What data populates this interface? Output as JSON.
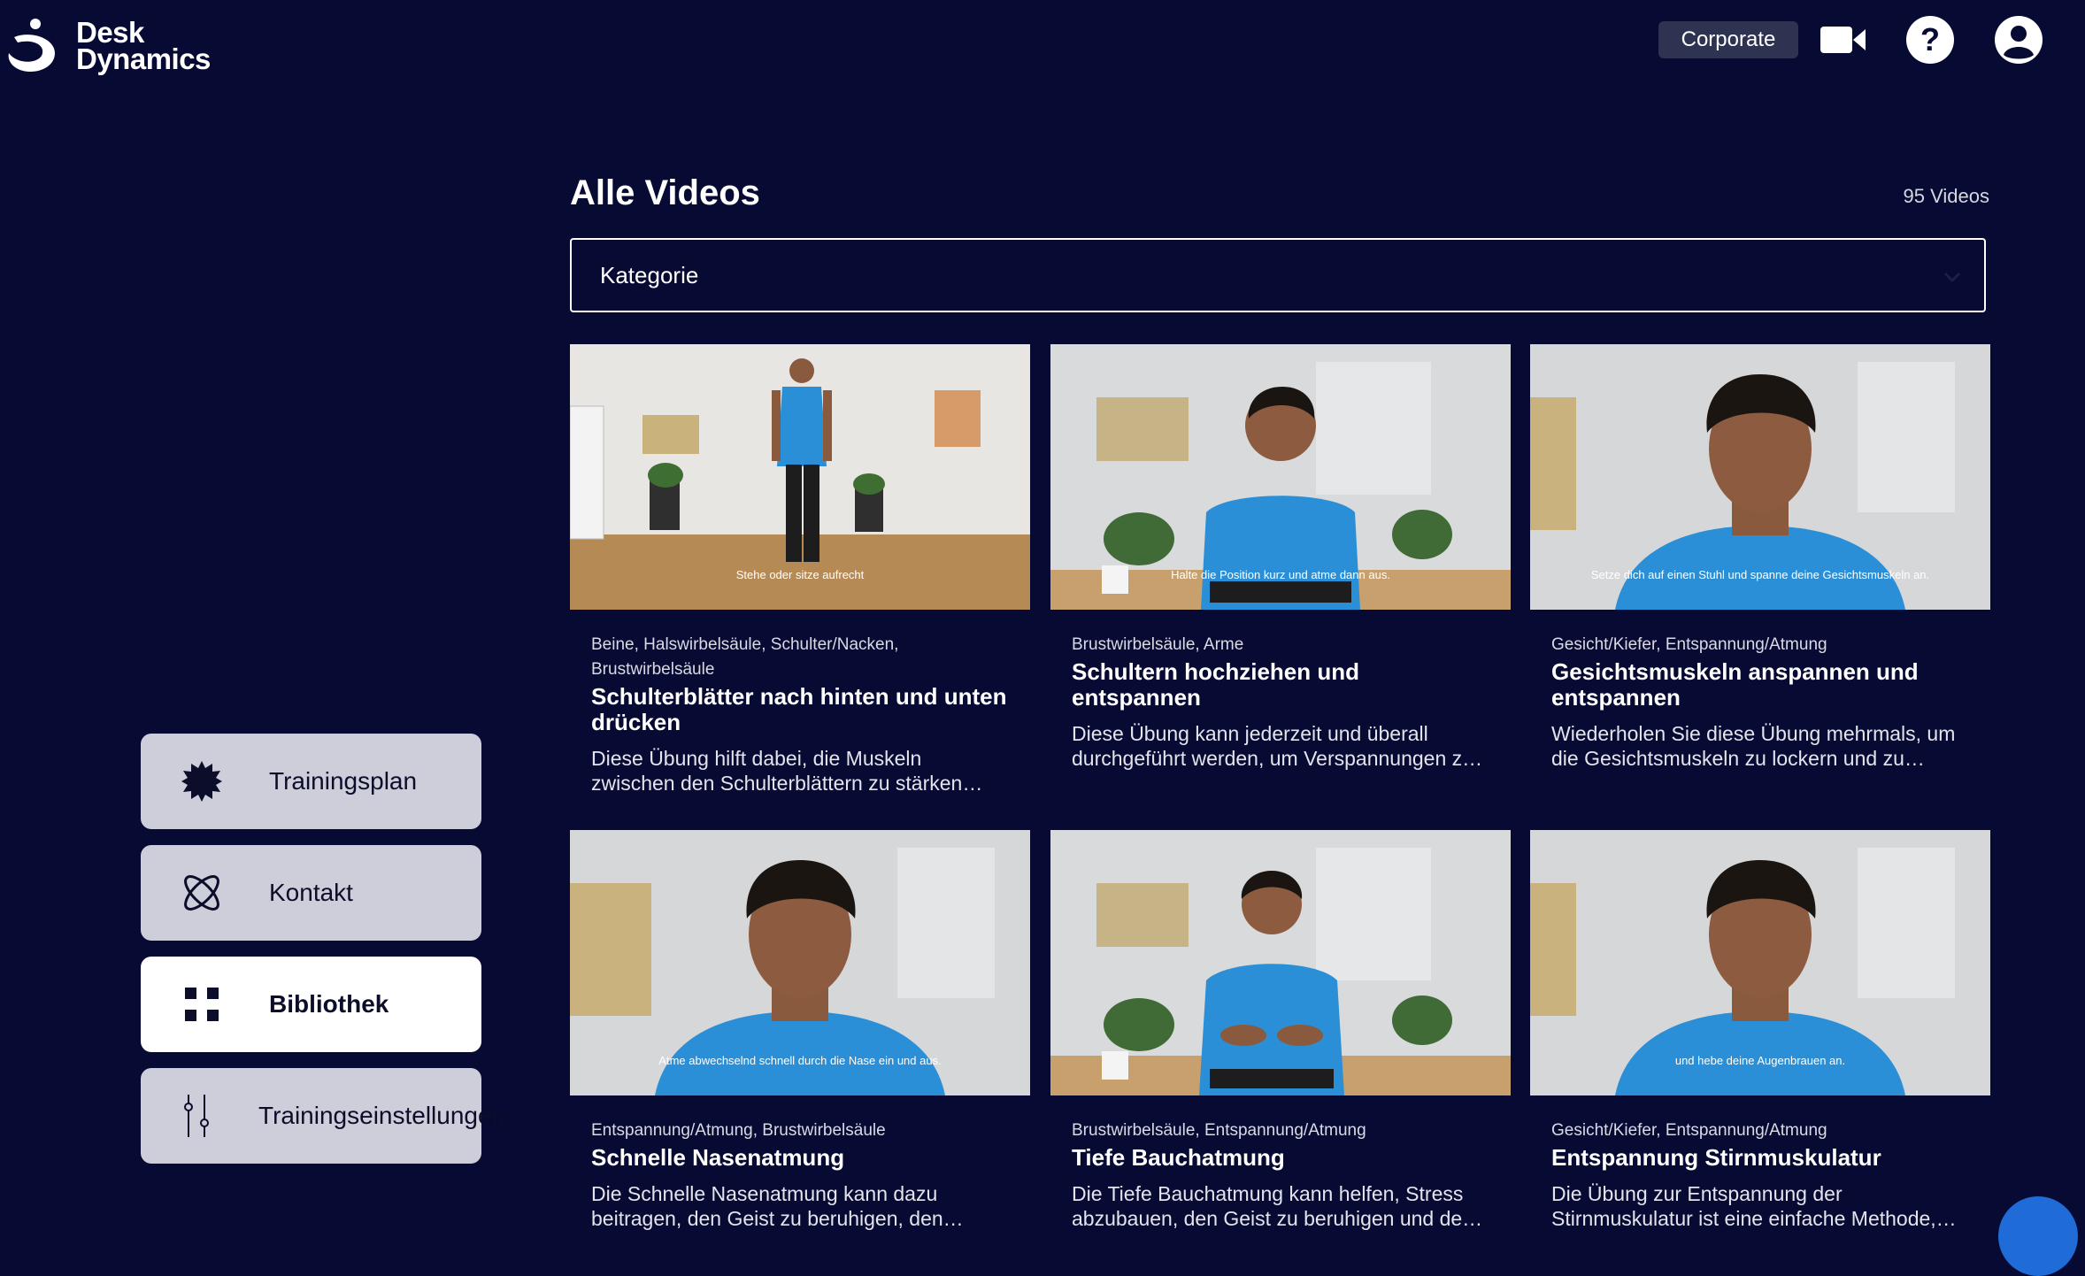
{
  "header": {
    "logo_line1": "Desk",
    "logo_line2": "Dynamics",
    "corporate_label": "Corporate"
  },
  "sidebar": {
    "items": [
      {
        "label": "Trainingsplan",
        "icon": "gear-badge-icon",
        "active": false
      },
      {
        "label": "Kontakt",
        "icon": "atom-icon",
        "active": false
      },
      {
        "label": "Bibliothek",
        "icon": "grid-icon",
        "active": true
      },
      {
        "label": "Trainingseinstellungen",
        "icon": "sliders-icon",
        "active": false
      }
    ]
  },
  "main": {
    "title": "Alle Videos",
    "count": "95 Videos",
    "filter": {
      "value": "Kategorie"
    },
    "videos": [
      {
        "tags": "Beine, Halswirbelsäule, Schulter/Nacken, Brustwirbelsäule",
        "title": "Schulterblätter nach hinten und unten drücken",
        "desc": "Diese Übung hilft dabei, die Muskeln zwischen den Schulterblättern zu stärken…",
        "caption": "Stehe oder sitze aufrecht"
      },
      {
        "tags": "Brustwirbelsäule, Arme",
        "title": "Schultern hochziehen und entspannen",
        "desc": "Diese Übung kann jederzeit und überall durchgeführt werden, um Verspannungen z…",
        "caption": "Halte die Position kurz und atme dann aus."
      },
      {
        "tags": "Gesicht/Kiefer, Entspannung/Atmung",
        "title": "Gesichtsmuskeln anspannen und entspannen",
        "desc": "Wiederholen Sie diese Übung mehrmals, um die Gesichtsmuskeln zu lockern und zu…",
        "caption": "Setze dich auf einen Stuhl und spanne deine Gesichtsmuskeln an."
      },
      {
        "tags": "Entspannung/Atmung, Brustwirbelsäule",
        "title": "Schnelle Nasenatmung",
        "desc": "Die Schnelle Nasenatmung kann dazu beitragen, den Geist zu beruhigen, den Foku…",
        "caption": "Atme abwechselnd schnell durch die Nase ein und aus."
      },
      {
        "tags": "Brustwirbelsäule, Entspannung/Atmung",
        "title": "Tiefe Bauchatmung",
        "desc": "Die Tiefe Bauchatmung kann helfen, Stress abzubauen, den Geist zu beruhigen und de…",
        "caption": ""
      },
      {
        "tags": "Gesicht/Kiefer, Entspannung/Atmung",
        "title": "Entspannung Stirnmuskulatur",
        "desc": "Die Übung zur Entspannung der Stirnmuskulatur ist eine einfache Methode,…",
        "caption": "und hebe deine Augenbrauen an."
      }
    ]
  },
  "colors": {
    "background": "#070a32",
    "nav_inactive": "#cdced9",
    "nav_active": "#ffffff",
    "shirt_blue": "#2a8fd6",
    "fab_blue": "#1f6bd8"
  }
}
